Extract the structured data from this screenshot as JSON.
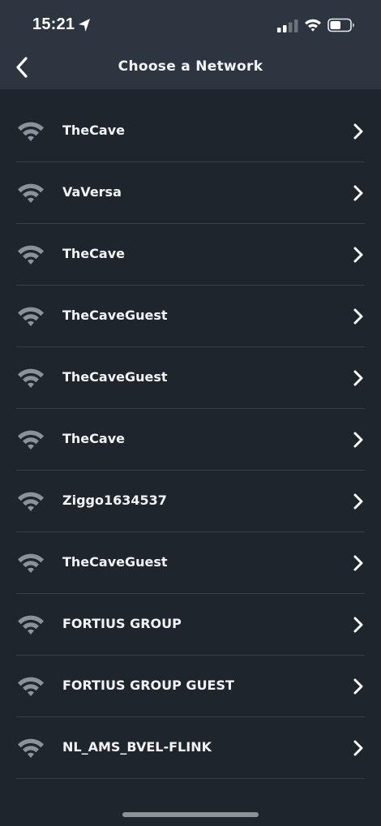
{
  "status_bar": {
    "time": "15:21",
    "location_icon": "location-arrow-icon",
    "signal_icon": "cellular-signal-icon",
    "wifi_icon": "wifi-icon",
    "battery_icon": "battery-icon"
  },
  "header": {
    "title": "Choose a Network",
    "back_icon": "chevron-left-icon"
  },
  "networks": [
    {
      "ssid": "TheCave"
    },
    {
      "ssid": "VaVersa"
    },
    {
      "ssid": "TheCave"
    },
    {
      "ssid": "TheCaveGuest"
    },
    {
      "ssid": "TheCaveGuest"
    },
    {
      "ssid": "TheCave"
    },
    {
      "ssid": "Ziggo1634537"
    },
    {
      "ssid": "TheCaveGuest"
    },
    {
      "ssid": "FORTIUS GROUP"
    },
    {
      "ssid": "FORTIUS GROUP GUEST"
    },
    {
      "ssid": "NL_AMS_BVEL-FLINK"
    }
  ],
  "colors": {
    "header_bg": "#2d3640",
    "list_bg": "#1f252c",
    "wifi_icon": "#8a929b",
    "text": "#f1f3f5",
    "divider": "#353d46"
  }
}
